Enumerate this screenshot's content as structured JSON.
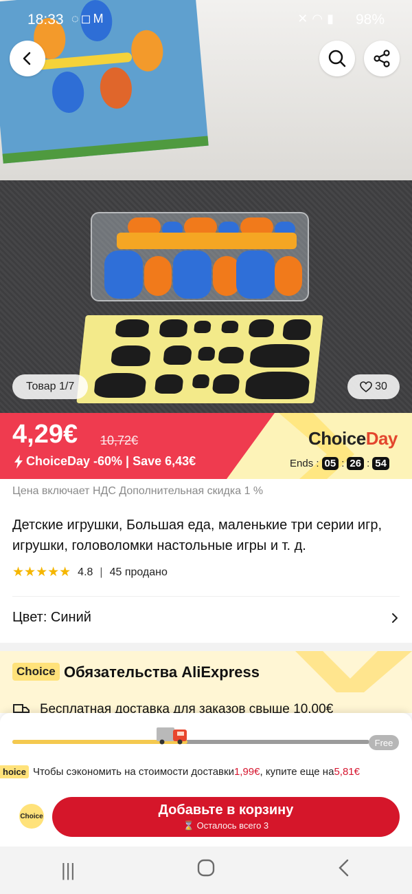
{
  "status_bar": {
    "time": "18:33",
    "left_icons": [
      "viber-icon",
      "instagram-icon",
      "gmail-icon"
    ],
    "battery": "98%"
  },
  "gallery": {
    "counter": "Товар 1/7",
    "likes": "30"
  },
  "price": {
    "current": "4,29€",
    "original": "10,72€",
    "promo": "ChoiceDay -60% | Save 6,43€",
    "brand_choice": "Choice",
    "brand_day": "Day",
    "ends_label": "Ends :",
    "timer": [
      "05",
      "26",
      "54"
    ],
    "accent_color": "#ef3b4f"
  },
  "product": {
    "vat_note": "Цена включает НДС Дополнительная скидка 1 %",
    "title": "Детские игрушки, Большая еда, маленькие три серии игр, игрушки, головоломки настольные игры и т. д.",
    "rating": "4.8",
    "sold": "45 продано",
    "stars": 5,
    "color_label": "Цвет: Синий"
  },
  "choice": {
    "badge": "Choice",
    "title": "Обязательства AliExpress",
    "shipping": "Бесплатная доставка для заказов свыше 10,00€"
  },
  "shipping_sheet": {
    "progress": 0.49,
    "free_label": "Free",
    "mini_badge": "hoice",
    "save_prefix": "Чтобы сэкономить на стоимости доставки ",
    "save_amount": "1,99€",
    "save_middle": ", купите еще на ",
    "save_remaining": "5,81€"
  },
  "cart": {
    "choice_circle": "Choice",
    "label": "Добавьте в корзину",
    "stock": "Осталось всего 3",
    "button_color": "#d5162a"
  }
}
